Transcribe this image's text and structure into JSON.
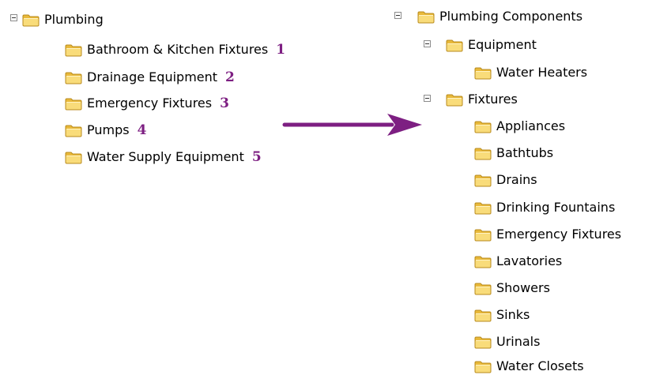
{
  "left_tree": {
    "root": {
      "label": "Plumbing"
    },
    "children": [
      {
        "label": "Bathroom & Kitchen Fixtures",
        "number": "1"
      },
      {
        "label": "Drainage Equipment",
        "number": "2"
      },
      {
        "label": "Emergency Fixtures",
        "number": "3"
      },
      {
        "label": "Pumps",
        "number": "4"
      },
      {
        "label": "Water Supply Equipment",
        "number": "5"
      }
    ]
  },
  "right_tree": {
    "root": {
      "label": "Plumbing Components"
    },
    "equipment": {
      "label": "Equipment",
      "children": [
        {
          "label": "Water Heaters"
        }
      ]
    },
    "fixtures": {
      "label": "Fixtures",
      "children": [
        {
          "label": "Appliances"
        },
        {
          "label": "Bathtubs"
        },
        {
          "label": "Drains"
        },
        {
          "label": "Drinking Fountains"
        },
        {
          "label": "Emergency Fixtures"
        },
        {
          "label": "Lavatories"
        },
        {
          "label": "Showers"
        },
        {
          "label": "Sinks"
        },
        {
          "label": "Urinals"
        },
        {
          "label": "Water Closets"
        }
      ]
    }
  },
  "icons": {
    "folder": "folder-icon",
    "collapse": "collapse-toggle-icon",
    "arrow": "arrow-right-icon"
  },
  "colors": {
    "number": "#7d1f82",
    "arrow": "#7d1f82",
    "folder_fill": "#f6d26b",
    "folder_stroke": "#b88a1c"
  }
}
